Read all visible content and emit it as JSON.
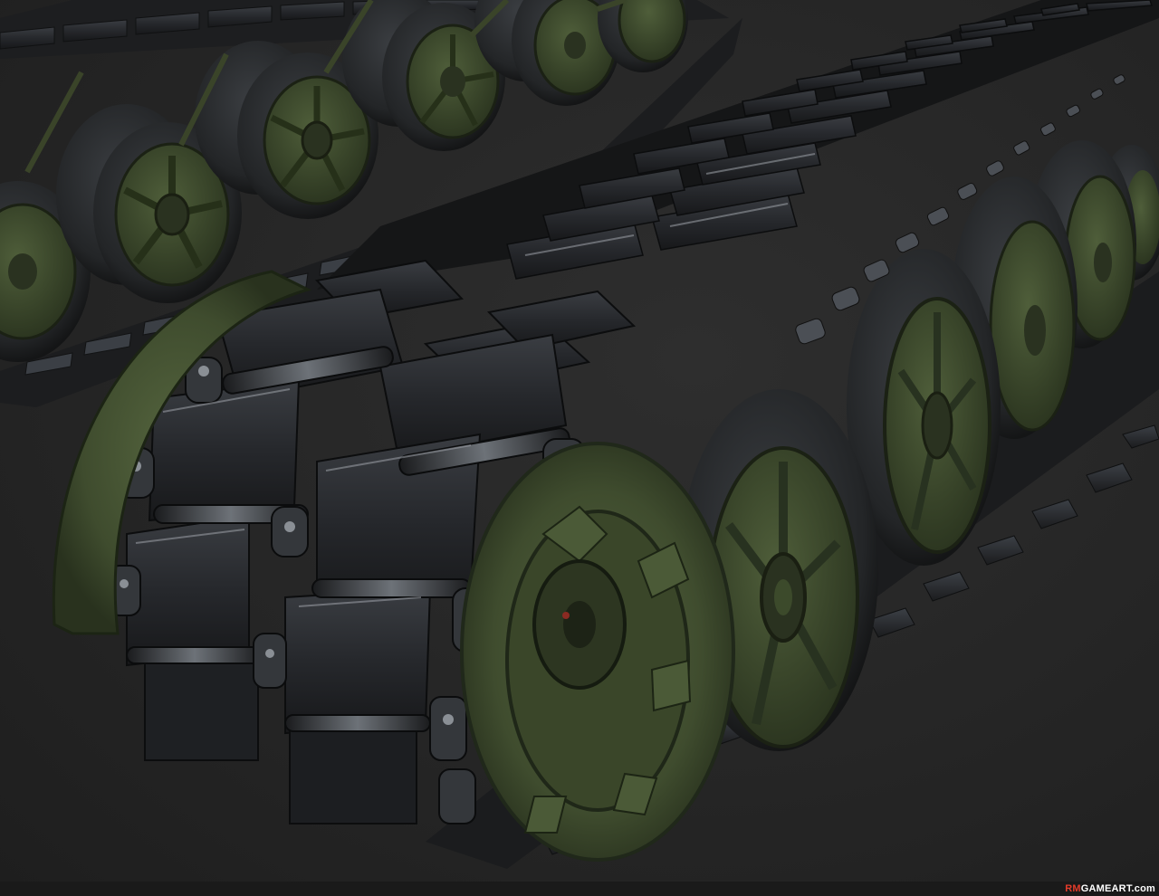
{
  "image": {
    "subject": "tank-track-render",
    "colors": {
      "background": "#262626",
      "track_metal": "#2b2d30",
      "track_pad": "#1d1f22",
      "wheel_rubber": "#222426",
      "wheel_hub_green": "#3d4a2c",
      "sprocket_green": "#465636",
      "highlight": "#8d9298"
    }
  },
  "watermark": {
    "prefix": "RM",
    "rest": "GAMEART.com"
  }
}
